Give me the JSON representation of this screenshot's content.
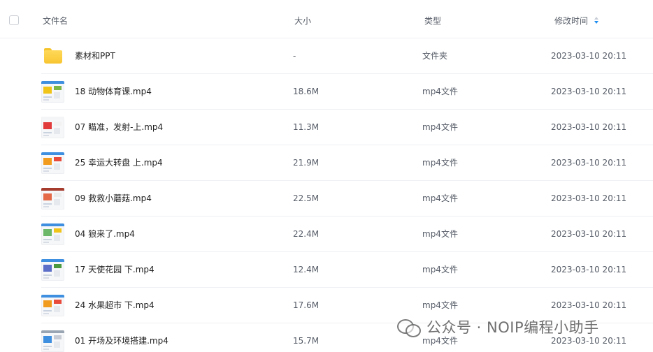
{
  "header": {
    "name_label": "文件名",
    "size_label": "大小",
    "type_label": "类型",
    "mtime_label": "修改时间",
    "sort_icon": "sort-desc-icon"
  },
  "rows": [
    {
      "name": "素材和PPT",
      "size": "-",
      "type": "文件夹",
      "mtime": "2023-03-10 20:11",
      "kind": "folder"
    },
    {
      "name": "18 动物体育课.mp4",
      "size": "18.6M",
      "type": "mp4文件",
      "mtime": "2023-03-10 20:11",
      "kind": "video",
      "accent": "#3f8fe0",
      "c1": "#f0c419",
      "c2": "#7ab648"
    },
    {
      "name": "07 瞄准，发射-上.mp4",
      "size": "11.3M",
      "type": "mp4文件",
      "mtime": "2023-03-10 20:11",
      "kind": "video",
      "accent": "#f4f5f7",
      "c1": "#e23b3b",
      "c2": "#f2f2f2"
    },
    {
      "name": "25 幸运大转盘 上.mp4",
      "size": "21.9M",
      "type": "mp4文件",
      "mtime": "2023-03-10 20:11",
      "kind": "video",
      "accent": "#3f8fe0",
      "c1": "#f29c1f",
      "c2": "#e84b3c"
    },
    {
      "name": "09 救救小蘑菇.mp4",
      "size": "22.5M",
      "type": "mp4文件",
      "mtime": "2023-03-10 20:11",
      "kind": "video",
      "accent": "#a53c2e",
      "c1": "#e46a4a",
      "c2": "#ececec"
    },
    {
      "name": "04 狼来了.mp4",
      "size": "22.4M",
      "type": "mp4文件",
      "mtime": "2023-03-10 20:11",
      "kind": "video",
      "accent": "#3f8fe0",
      "c1": "#6cb86a",
      "c2": "#f0c419"
    },
    {
      "name": "17 天使花园 下.mp4",
      "size": "12.4M",
      "type": "mp4文件",
      "mtime": "2023-03-10 20:11",
      "kind": "video",
      "accent": "#3f8fe0",
      "c1": "#5b6fc8",
      "c2": "#4c9a3f"
    },
    {
      "name": "24 水果超市 下.mp4",
      "size": "17.6M",
      "type": "mp4文件",
      "mtime": "2023-03-10 20:11",
      "kind": "video",
      "accent": "#3f8fe0",
      "c1": "#f29c1f",
      "c2": "#e84b3c"
    },
    {
      "name": "01 开场及环境搭建.mp4",
      "size": "15.7M",
      "type": "mp4文件",
      "mtime": "2023-03-10 20:11",
      "kind": "video",
      "accent": "#9aa5b3",
      "c1": "#3f8fe0",
      "c2": "#c7ccd4"
    }
  ],
  "watermark": {
    "icon": "wechat-icon",
    "text": "公众号 · NOIP编程小助手"
  }
}
